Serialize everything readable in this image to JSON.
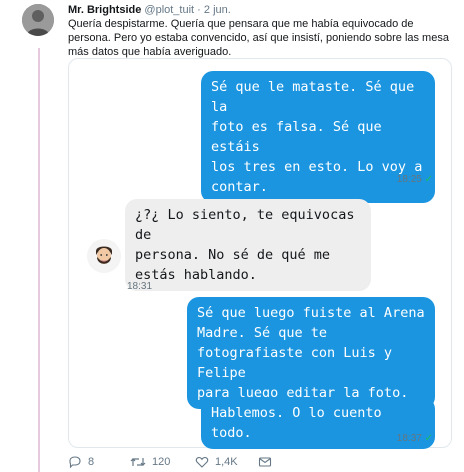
{
  "tweet": {
    "author": "Mr. Brightside",
    "handle": "@plot_tuit",
    "separator": "·",
    "date": "2 jun.",
    "text": "Quería despistarme. Quería que pensara que me había equivocado de persona. Pero yo estaba convencido, así que insistí, poniendo sobre las mesa más datos que había averiguado."
  },
  "chat": {
    "messages": [
      {
        "direction": "out",
        "text": "Sé que le mataste. Sé que la\nfoto es falsa. Sé que estáis\nlos tres en esto. Lo voy a\ncontar."
      },
      {
        "direction": "in",
        "text": "¿?¿ Lo siento, te equivocas de\npersona. No sé de qué me\nestás hablando."
      },
      {
        "direction": "out",
        "text": "Sé que luego fuiste al Arena\nMadre. Sé que te\nfotografiaste con Luis y Felipe\npara luego editar la foto."
      },
      {
        "direction": "out",
        "text": "Hablemos. O lo cuento todo."
      }
    ],
    "timestamps": [
      {
        "time": "18:25",
        "check": "✓"
      },
      {
        "time": "18:31"
      },
      {
        "time": "18:37",
        "check": "✓"
      }
    ]
  },
  "actions": {
    "replies": "8",
    "retweets": "120",
    "likes": "1,4K"
  },
  "colors": {
    "accent": "#1b95e0",
    "thread": "#e6c9df",
    "like": "#e0245e"
  }
}
